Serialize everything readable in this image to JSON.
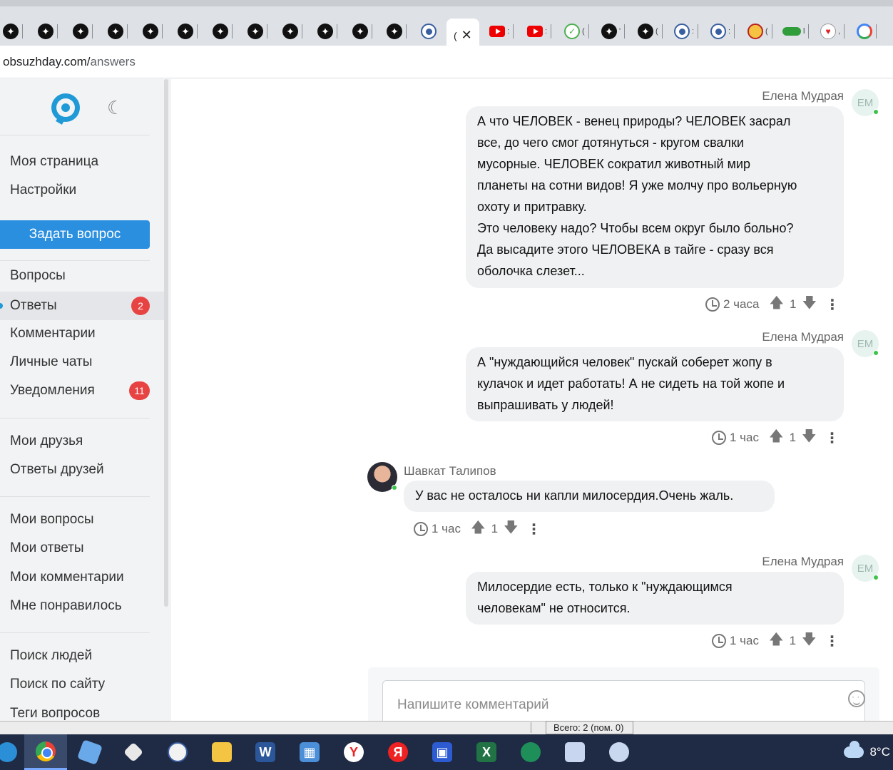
{
  "browser": {
    "active_tab_title": "(",
    "url_host": "obsuzhday.com/",
    "url_path": "answers",
    "tab_mini_labels": [
      ":",
      "(",
      "'",
      "(",
      ":",
      ":",
      "(",
      "l",
      ","
    ]
  },
  "sidebar": {
    "top_links": [
      "Моя страница",
      "Настройки"
    ],
    "ask_button": "Задать вопрос",
    "section1": [
      {
        "label": "Вопросы"
      },
      {
        "label": "Ответы",
        "badge": "2"
      },
      {
        "label": "Комментарии"
      },
      {
        "label": "Личные чаты"
      },
      {
        "label": "Уведомления",
        "badge": "11"
      }
    ],
    "section2": [
      "Мои друзья",
      "Ответы друзей"
    ],
    "section3": [
      "Мои вопросы",
      "Мои ответы",
      "Мои комментарии",
      "Мне понравилось"
    ],
    "section4": [
      "Поиск людей",
      "Поиск по сайту",
      "Теги вопросов"
    ]
  },
  "messages": [
    {
      "author": "Елена Мудрая",
      "avatar": "ЕМ",
      "text_lines": [
        "А что ЧЕЛОВЕК - венец природы? ЧЕЛОВЕК засрал",
        "все, до чего смог дотянуться - кругом свалки",
        "мусорные. ЧЕЛОВЕК сократил животный мир",
        "планеты на сотни видов! Я уже молчу про вольерную",
        "охоту и притравку.",
        "Это человеку надо? Чтобы всем округ было больно?",
        "Да высадите этого ЧЕЛОВЕКА в тайге - сразу вся",
        "оболочка слезет..."
      ],
      "time": "2 часа",
      "votes": "1"
    },
    {
      "author": "Елена Мудрая",
      "avatar": "ЕМ",
      "text_lines": [
        "А \"нуждающийся человек\" пускай соберет жопу в",
        "кулачок и идет работать! А не сидеть на той жопе и",
        "выпрашивать у людей!"
      ],
      "time": "1 час",
      "votes": "1"
    },
    {
      "author": "Шавкат Талипов",
      "text_lines": [
        "У вас не осталось ни капли милосердия.Очень жаль."
      ],
      "time": "1 час",
      "votes": "1"
    },
    {
      "author": "Елена Мудрая",
      "avatar": "ЕМ",
      "text_lines": [
        "Милосердие есть, только к \"нуждающимся",
        "человекам\" не относится."
      ],
      "time": "1 час",
      "votes": "1"
    }
  ],
  "comment": {
    "placeholder": "Напишите комментарий"
  },
  "status_strip": {
    "text": "Всего: 2 (пом. 0)"
  },
  "taskbar": {
    "weather_temp": "8°C"
  },
  "colors": {
    "accent": "#2b8fe0",
    "badge": "#e74343",
    "online": "#3bc34a"
  }
}
